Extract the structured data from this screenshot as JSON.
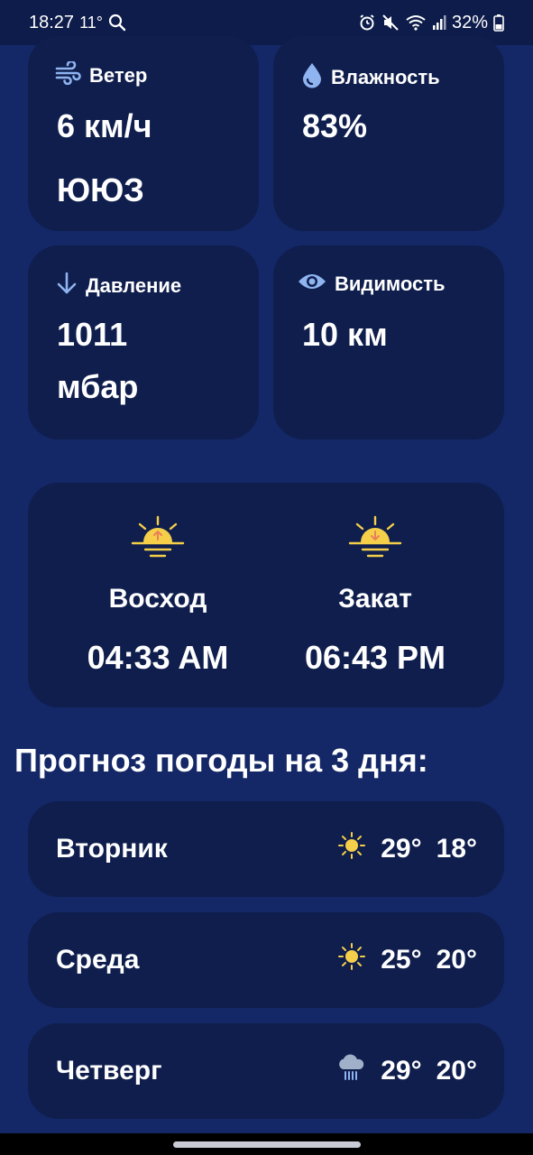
{
  "status_bar": {
    "time": "18:27",
    "temp": "11°",
    "battery": "32%"
  },
  "wind": {
    "title": "Ветер",
    "speed": "6 км/ч",
    "direction": "ЮЮЗ"
  },
  "humidity": {
    "title": "Влажность",
    "value": "83%"
  },
  "pressure": {
    "title": "Давление",
    "value_line1": "1011",
    "value_line2": "мбар"
  },
  "visibility": {
    "title": "Видимость",
    "value": "10 км"
  },
  "sun": {
    "sunrise_label": "Восход",
    "sunrise_time": "04:33 AM",
    "sunset_label": "Закат",
    "sunset_time": "06:43 PM"
  },
  "forecast": {
    "title": "Прогноз погоды на 3 дня:",
    "days": [
      {
        "name": "Вторник",
        "icon": "sun-icon",
        "high": "29°",
        "low": "18°"
      },
      {
        "name": "Среда",
        "icon": "sun-icon",
        "high": "25°",
        "low": "20°"
      },
      {
        "name": "Четверг",
        "icon": "rain-cloud-icon",
        "high": "29°",
        "low": "20°"
      }
    ]
  },
  "colors": {
    "background": "#142766",
    "card": "#0f1e4d",
    "accent_icon": "#8fb4f0",
    "sun": "#f5cf4a"
  }
}
